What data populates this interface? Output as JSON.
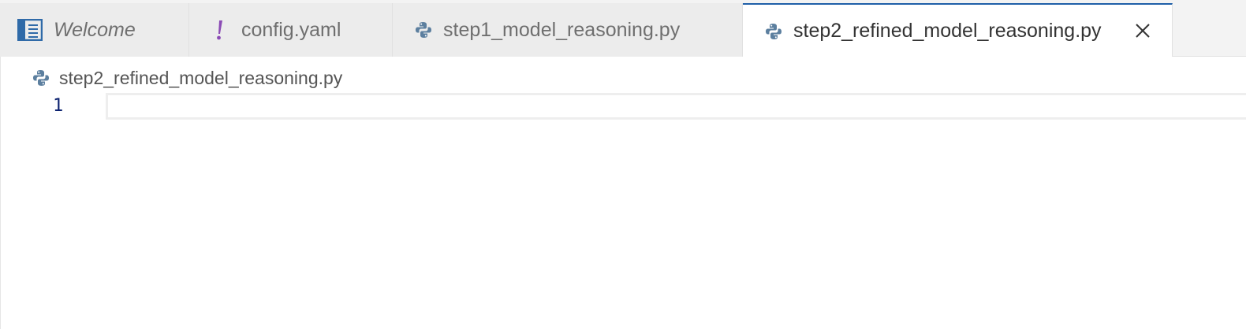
{
  "tabs": [
    {
      "label": "Welcome",
      "icon": "welcome-icon",
      "active": false
    },
    {
      "label": "config.yaml",
      "icon": "exclamation-icon",
      "active": false
    },
    {
      "label": "step1_model_reasoning.py",
      "icon": "python-icon",
      "active": false
    },
    {
      "label": "step2_refined_model_reasoning.py",
      "icon": "python-icon",
      "active": true
    }
  ],
  "breadcrumb": {
    "file": "step2_refined_model_reasoning.py",
    "icon": "python-icon"
  },
  "editor": {
    "lines": [
      {
        "number": "1",
        "text": ""
      }
    ]
  },
  "colors": {
    "active_tab_border": "#1f5fa8",
    "yaml_icon": "#8b4bb5",
    "python_icon": "#5c7f9f",
    "welcome_icon": "#2f6aa8",
    "line_number": "#0b216f"
  }
}
